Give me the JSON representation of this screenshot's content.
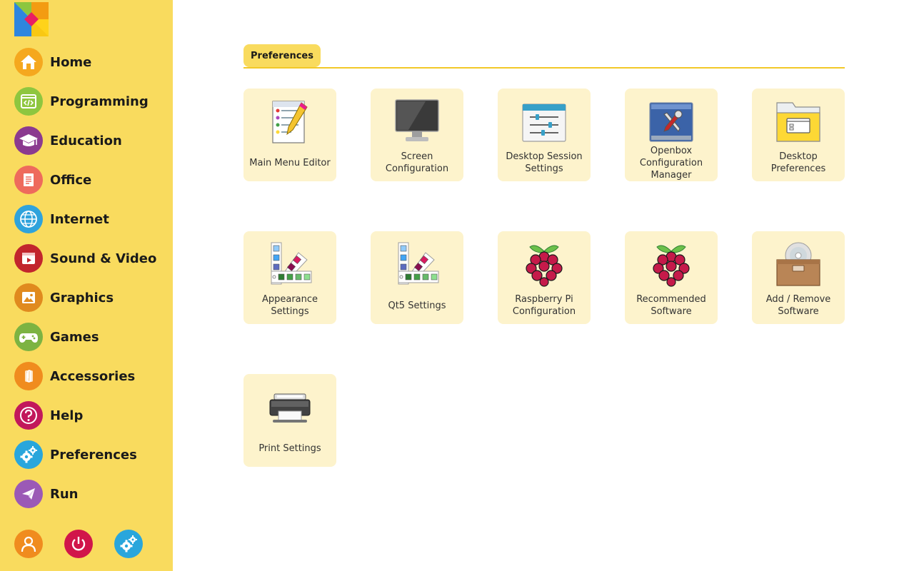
{
  "sidebar": {
    "items": [
      {
        "label": "Home",
        "icon": "home-icon",
        "color": "#f5a81e"
      },
      {
        "label": "Programming",
        "icon": "code-icon",
        "color": "#8ec63f"
      },
      {
        "label": "Education",
        "icon": "graduation-cap-icon",
        "color": "#8b3a8f"
      },
      {
        "label": "Office",
        "icon": "document-icon",
        "color": "#ee6a5c"
      },
      {
        "label": "Internet",
        "icon": "globe-icon",
        "color": "#2fa3dc"
      },
      {
        "label": "Sound & Video",
        "icon": "video-icon",
        "color": "#c2252d"
      },
      {
        "label": "Graphics",
        "icon": "image-icon",
        "color": "#e08a1e"
      },
      {
        "label": "Games",
        "icon": "gamepad-icon",
        "color": "#7cb342"
      },
      {
        "label": "Accessories",
        "icon": "paperclip-icon",
        "color": "#f08c1e"
      },
      {
        "label": "Help",
        "icon": "help-icon",
        "color": "#c2185b"
      },
      {
        "label": "Preferences",
        "icon": "gears-icon",
        "color": "#29a6dc"
      },
      {
        "label": "Run",
        "icon": "paper-plane-icon",
        "color": "#9b59b6"
      }
    ],
    "bottom_buttons": [
      {
        "icon": "user-icon",
        "color": "#f08c1e"
      },
      {
        "icon": "power-icon",
        "color": "#d1154a"
      },
      {
        "icon": "gears-icon",
        "color": "#29a6dc"
      }
    ]
  },
  "main": {
    "tab_label": "Preferences",
    "tiles": [
      {
        "label": "Main Menu Editor",
        "icon": "menu-editor-icon"
      },
      {
        "label": "Screen Configuration",
        "icon": "monitor-icon"
      },
      {
        "label": "Desktop Session Settings",
        "icon": "session-sliders-icon"
      },
      {
        "label": "Openbox Configuration Manager",
        "icon": "openbox-tools-icon"
      },
      {
        "label": "Desktop Preferences",
        "icon": "folder-window-icon"
      },
      {
        "label": "Appearance Settings",
        "icon": "color-palette-icon"
      },
      {
        "label": "Qt5 Settings",
        "icon": "color-palette-icon"
      },
      {
        "label": "Raspberry Pi Configuration",
        "icon": "raspberry-icon"
      },
      {
        "label": "Recommended Software",
        "icon": "raspberry-icon"
      },
      {
        "label": "Add / Remove Software",
        "icon": "package-box-icon"
      },
      {
        "label": "Print Settings",
        "icon": "printer-icon"
      }
    ]
  }
}
